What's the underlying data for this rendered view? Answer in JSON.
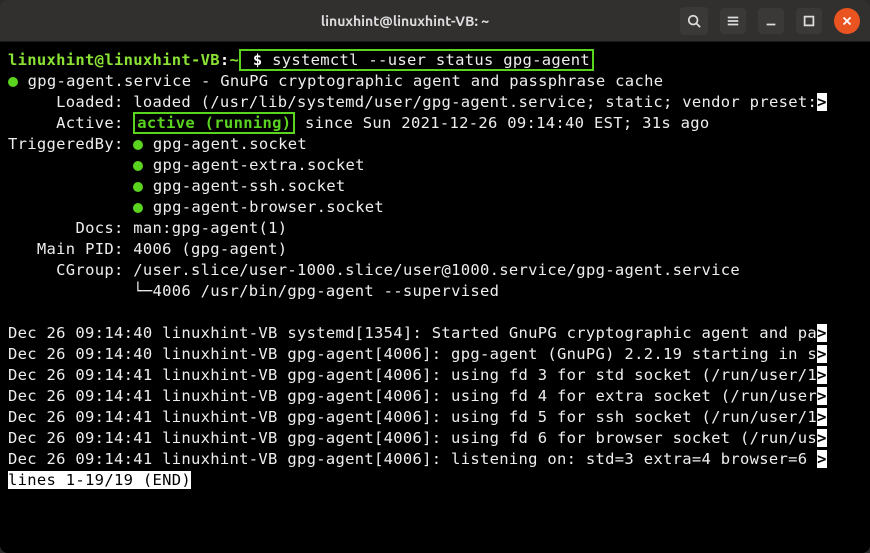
{
  "titlebar": {
    "title": "linuxhint@linuxhint-VB: ~"
  },
  "prompt": {
    "user": "linuxhint@linuxhint-VB",
    "path": "~",
    "symbol": "$",
    "command": "systemctl --user status gpg-agent"
  },
  "service": {
    "name": "gpg-agent.service - GnuPG cryptographic agent and passphrase cache",
    "loaded_label": "Loaded:",
    "loaded_value": "loaded (/usr/lib/systemd/user/gpg-agent.service; static; vendor preset:",
    "active_label": "Active:",
    "active_status": "active (running)",
    "active_since": " since Sun 2021-12-26 09:14:40 EST; 31s ago",
    "triggered_label": "TriggeredBy:",
    "triggers": [
      "gpg-agent.socket",
      "gpg-agent-extra.socket",
      "gpg-agent-ssh.socket",
      "gpg-agent-browser.socket"
    ],
    "docs_label": "Docs:",
    "docs_value": "man:gpg-agent(1)",
    "pid_label": "Main PID:",
    "pid_value": "4006 (gpg-agent)",
    "cgroup_label": "CGroup:",
    "cgroup_path": "/user.slice/user-1000.slice/user@1000.service/gpg-agent.service",
    "cgroup_proc": "└─4006 /usr/bin/gpg-agent --supervised"
  },
  "log": [
    "Dec 26 09:14:40 linuxhint-VB systemd[1354]: Started GnuPG cryptographic agent and pa",
    "Dec 26 09:14:40 linuxhint-VB gpg-agent[4006]: gpg-agent (GnuPG) 2.2.19 starting in s",
    "Dec 26 09:14:41 linuxhint-VB gpg-agent[4006]: using fd 3 for std socket (/run/user/1",
    "Dec 26 09:14:41 linuxhint-VB gpg-agent[4006]: using fd 4 for extra socket (/run/user",
    "Dec 26 09:14:41 linuxhint-VB gpg-agent[4006]: using fd 5 for ssh socket (/run/user/1",
    "Dec 26 09:14:41 linuxhint-VB gpg-agent[4006]: using fd 6 for browser socket (/run/us",
    "Dec 26 09:14:41 linuxhint-VB gpg-agent[4006]: listening on: std=3 extra=4 browser=6 "
  ],
  "pager": {
    "status": "lines 1-19/19 (END)"
  },
  "truncation_mark": ">"
}
